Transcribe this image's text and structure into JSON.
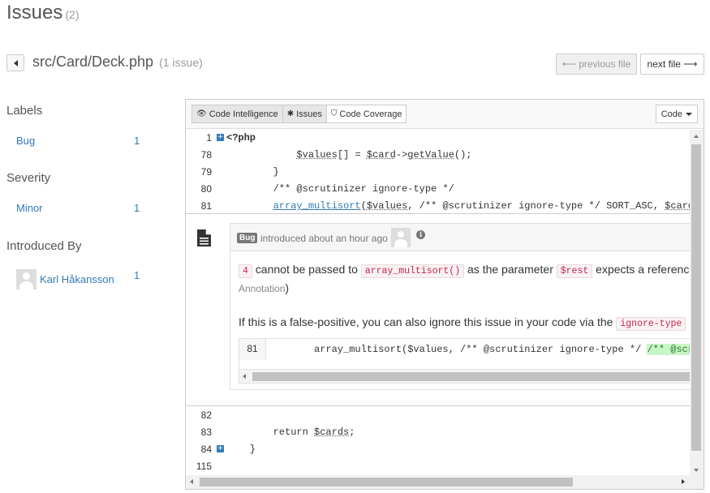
{
  "page": {
    "title": "Issues",
    "count": "(2)"
  },
  "file": {
    "path": "src/Card/Deck.php",
    "issue_count": "(1 issue)"
  },
  "nav": {
    "previous": "⟵ previous file",
    "next": "next file ⟶"
  },
  "sidebar": {
    "labels_heading": "Labels",
    "labels": [
      {
        "label": "Bug",
        "count": "1"
      }
    ],
    "severity_heading": "Severity",
    "severity": [
      {
        "label": "Minor",
        "count": "1"
      }
    ],
    "introduced_heading": "Introduced By",
    "authors": [
      {
        "name": "Karl Håkansson",
        "count": "1"
      }
    ]
  },
  "toolbar": {
    "code_intelligence": "Code Intelligence",
    "issues": "Issues",
    "code_coverage": "Code Coverage",
    "code_dropdown": "Code"
  },
  "code_top": [
    {
      "ln": "1",
      "text": "<?php",
      "expand": true
    },
    {
      "ln": "78",
      "text": "            $values[] = $card->getValue();"
    },
    {
      "ln": "79",
      "text": "        }"
    },
    {
      "ln": "80",
      "text": "        /** @scrutinizer ignore-type */"
    },
    {
      "ln": "81",
      "text": "        array_multisort($values, /** @scrutinizer ignore-type */ SORT_ASC, $card"
    }
  ],
  "issue": {
    "badge": "Bug",
    "meta": "introduced about an hour ago by",
    "msg_num": "4",
    "msg_part1": "cannot be passed to",
    "msg_func": "array_multisort()",
    "msg_part2": "as the parameter",
    "msg_param": "$rest",
    "msg_part3": "expects a reference",
    "annotation": "Annotation",
    "annotation_close": ")",
    "hint": "If this is a false-positive, you can also ignore this issue in your code via the",
    "hint_code": "ignore-type",
    "snippet_ln": "81",
    "snippet_code": "array_multisort($values, /** @scrutinizer ignore-type */ ",
    "snippet_hl": "/** @scr"
  },
  "code_bottom": [
    {
      "ln": "82",
      "text": ""
    },
    {
      "ln": "83",
      "text": "        return $cards;"
    },
    {
      "ln": "84",
      "text": "    }",
      "expand": true
    },
    {
      "ln": "115",
      "text": ""
    }
  ],
  "colors": {
    "link": "#337ab7",
    "code_red": "#c7254e",
    "highlight_green": "#c8f5c8"
  }
}
